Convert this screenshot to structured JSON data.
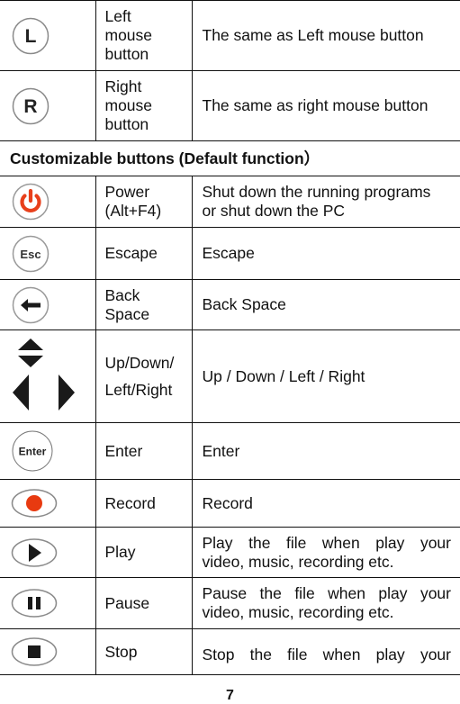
{
  "mouse_rows": [
    {
      "icon": "left-mouse-icon",
      "glyph": "L",
      "name": "Left mouse button",
      "name_lines": [
        "Left",
        "mouse",
        "button"
      ],
      "description": "The same as Left mouse button"
    },
    {
      "icon": "right-mouse-icon",
      "glyph": "R",
      "name": "Right mouse button",
      "name_lines": [
        "Right",
        "mouse",
        "button"
      ],
      "description": "The same as right mouse button"
    }
  ],
  "section_header": "Customizable buttons (Default function）",
  "custom_rows": [
    {
      "icon": "power-icon",
      "name_lines": [
        "Power",
        "(Alt+F4)"
      ],
      "description_lines": [
        "Shut down the running programs",
        "or shut down the PC"
      ]
    },
    {
      "icon": "esc-icon",
      "glyph": "Esc",
      "name_lines": [
        "Escape"
      ],
      "description_lines": [
        "Escape"
      ]
    },
    {
      "icon": "backspace-arrow-icon",
      "name_lines": [
        "Back",
        "Space"
      ],
      "description_lines": [
        "Back Space"
      ]
    },
    {
      "icon": "direction-arrows-icon",
      "name_lines": [
        "Up/Down/",
        "Left/Right"
      ],
      "description_lines": [
        "Up / Down / Left / Right"
      ]
    },
    {
      "icon": "enter-icon",
      "glyph": "Enter",
      "name_lines": [
        "Enter"
      ],
      "description_lines": [
        "Enter"
      ]
    },
    {
      "icon": "record-icon",
      "name_lines": [
        "Record"
      ],
      "description_lines": [
        "Record"
      ]
    },
    {
      "icon": "play-icon",
      "name_lines": [
        "Play"
      ],
      "description_lines": [
        "Play the file when play your",
        "video, music, recording etc."
      ]
    },
    {
      "icon": "pause-icon",
      "name_lines": [
        "Pause"
      ],
      "description_lines": [
        "Pause the file when play your",
        "video, music, recording etc."
      ]
    },
    {
      "icon": "stop-icon",
      "name_lines": [
        "Stop"
      ],
      "description_lines": [
        "Stop the file when play your"
      ]
    }
  ],
  "colors": {
    "power": "#e8401c",
    "record": "#e83a10",
    "border": "#111111",
    "icon_ring": "#9a9a9a"
  },
  "page_number": "7"
}
